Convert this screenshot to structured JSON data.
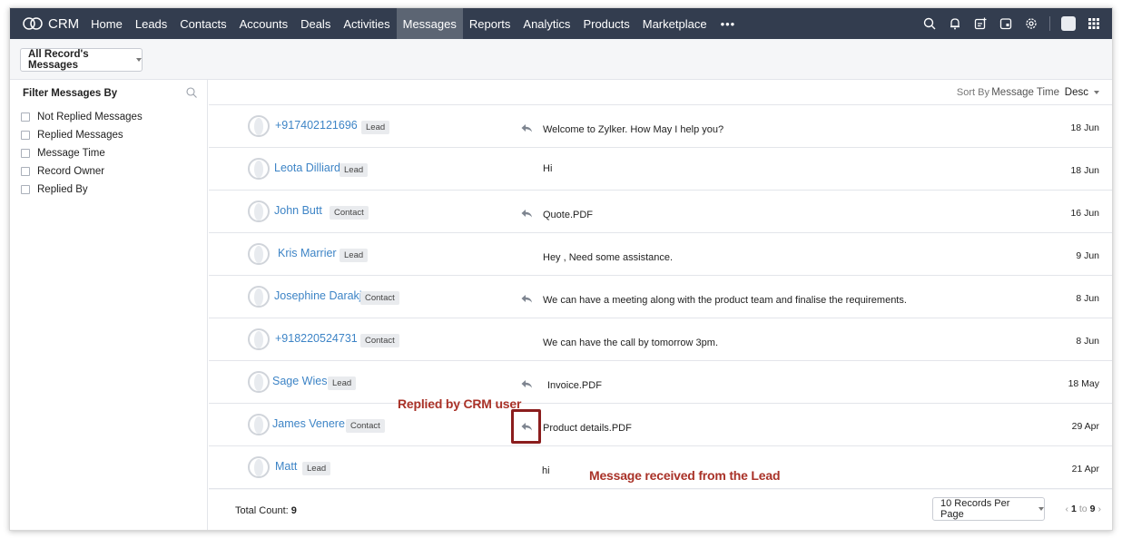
{
  "nav": {
    "brand": "CRM",
    "items": [
      "Home",
      "Leads",
      "Contacts",
      "Accounts",
      "Deals",
      "Activities",
      "Messages",
      "Reports",
      "Analytics",
      "Products",
      "Marketplace"
    ],
    "active": "Messages",
    "more": "•••"
  },
  "subheader": {
    "view_label": "All Record's Messages"
  },
  "sidebar": {
    "title": "Filter Messages By",
    "filters": [
      "Not Replied Messages",
      "Replied Messages",
      "Message Time",
      "Record Owner",
      "Replied By"
    ]
  },
  "sort": {
    "label": "Sort By",
    "field": "Message Time",
    "direction": "Desc"
  },
  "rows": [
    {
      "name": "+917402121696",
      "tag": "Lead",
      "replied": true,
      "message": "Welcome to Zylker. How May I help you?",
      "date": "18 Jun"
    },
    {
      "name": "Leota Dilliard",
      "tag": "Lead",
      "replied": false,
      "message": "Hi",
      "date": "18 Jun"
    },
    {
      "name": "John Butt",
      "tag": "Contact",
      "replied": true,
      "message": "Quote.PDF",
      "date": "16 Jun"
    },
    {
      "name": "Kris Marrier",
      "tag": "Lead",
      "replied": false,
      "message": "Hey , Need some assistance.",
      "date": "9 Jun"
    },
    {
      "name": "Josephine Darakjy",
      "tag": "Contact",
      "replied": true,
      "message": "We can have a meeting along with the product team and finalise the requirements.",
      "date": "8 Jun"
    },
    {
      "name": "+918220524731",
      "tag": "Contact",
      "replied": false,
      "message": "We can have the call by tomorrow 3pm.",
      "date": "8 Jun"
    },
    {
      "name": "Sage Wiese",
      "tag": "Lead",
      "replied": true,
      "message": "Invoice.PDF",
      "date": "18 May"
    },
    {
      "name": "James Venere",
      "tag": "Contact",
      "replied": true,
      "message": "Product details.PDF",
      "date": "29 Apr"
    },
    {
      "name": "Matt",
      "tag": "Lead",
      "replied": false,
      "message": "hi",
      "date": "21 Apr"
    }
  ],
  "annotations": {
    "replied_by": "Replied by CRM user",
    "received": "Message received from the Lead"
  },
  "footer": {
    "total_label": "Total Count:",
    "total_value": "9",
    "per_page": "10 Records Per Page",
    "page_from": "1",
    "page_to_word": "to",
    "page_to": "9"
  },
  "colors": {
    "nav_bg": "#333d4f",
    "nav_active": "#5c6573",
    "link": "#3d84c6",
    "annotation": "#a93228",
    "highlight_border": "#8b1d1d"
  }
}
